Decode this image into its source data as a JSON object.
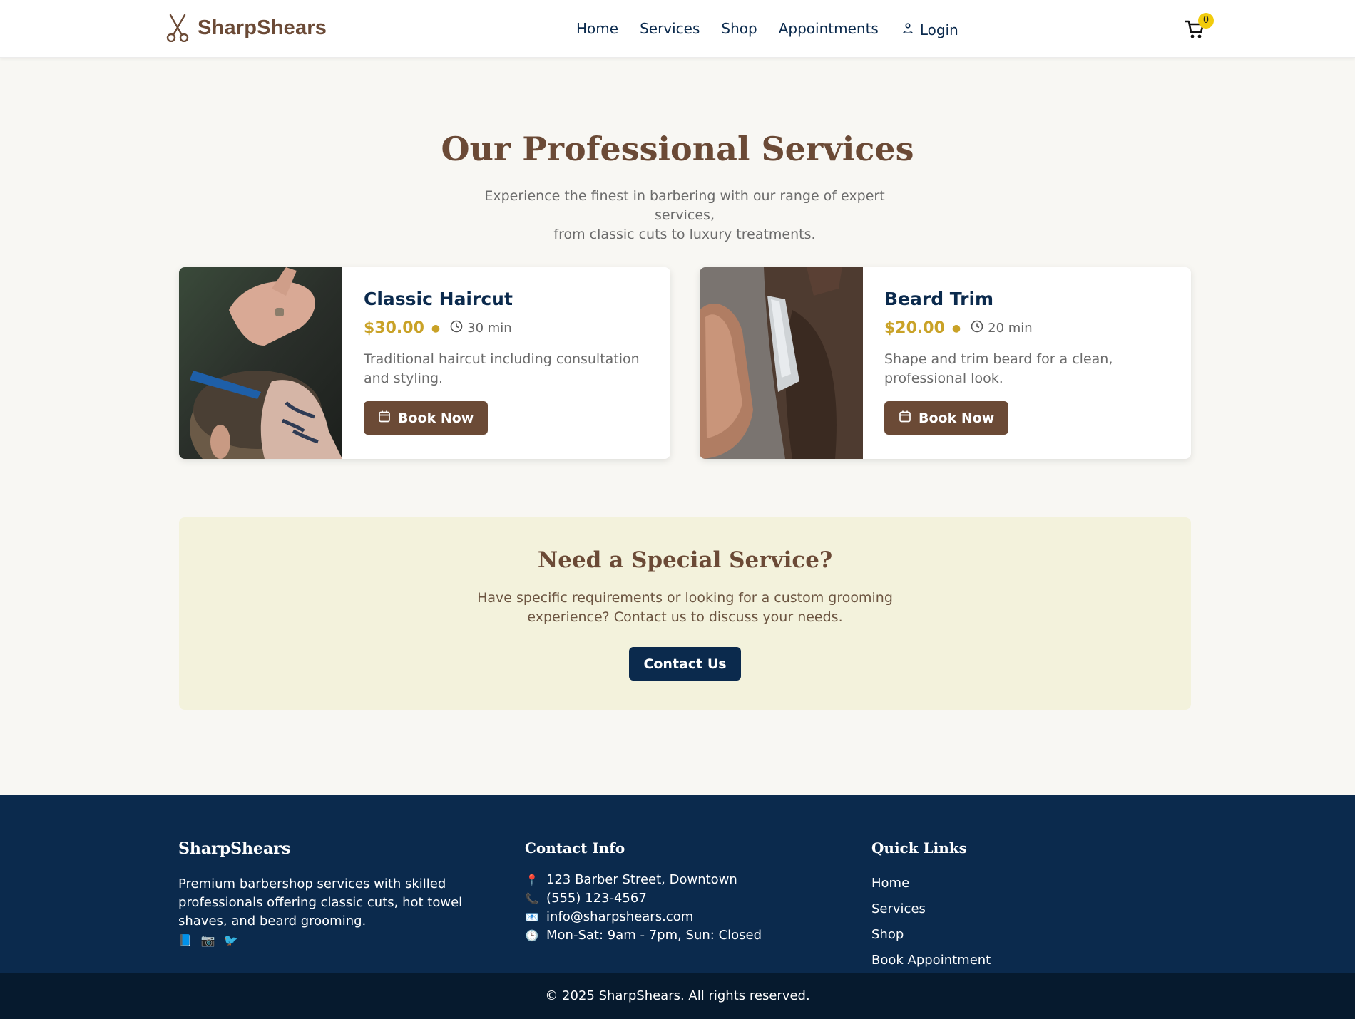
{
  "header": {
    "brand": "SharpShears",
    "nav": [
      "Home",
      "Services",
      "Shop",
      "Appointments"
    ],
    "login": "Login",
    "cart_count": "0"
  },
  "hero": {
    "title": "Our Professional Services",
    "subtitle_line1": "Experience the finest in barbering with our range of expert services,",
    "subtitle_line2": "from classic cuts to luxury treatments."
  },
  "services": [
    {
      "name": "Classic Haircut",
      "price": "$30.00",
      "duration": "30 min",
      "description": "Traditional haircut including consultation and styling.",
      "button": "Book Now"
    },
    {
      "name": "Beard Trim",
      "price": "$20.00",
      "duration": "20 min",
      "description": "Shape and trim beard for a clean, professional look.",
      "button": "Book Now"
    }
  ],
  "special": {
    "title": "Need a Special Service?",
    "text": "Have specific requirements or looking for a custom grooming experience? Contact us to discuss your needs.",
    "button": "Contact Us"
  },
  "footer": {
    "brand": "SharpShears",
    "about": "Premium barbershop services with skilled professionals offering classic cuts, hot towel shaves, and beard grooming.",
    "contact_title": "Contact Info",
    "address": "123 Barber Street, Downtown",
    "phone": "(555) 123-4567",
    "email": "info@sharpshears.com",
    "hours": "Mon-Sat: 9am - 7pm, Sun: Closed",
    "links_title": "Quick Links",
    "links": [
      "Home",
      "Services",
      "Shop",
      "Book Appointment"
    ],
    "copyright": "© 2025 SharpShears. All rights reserved."
  },
  "colors": {
    "brand_brown": "#6b4a36",
    "navy": "#0b2a4d",
    "gold": "#c9a227",
    "special_bg": "#f3f2dc",
    "page_bg": "#f8f7f3"
  }
}
